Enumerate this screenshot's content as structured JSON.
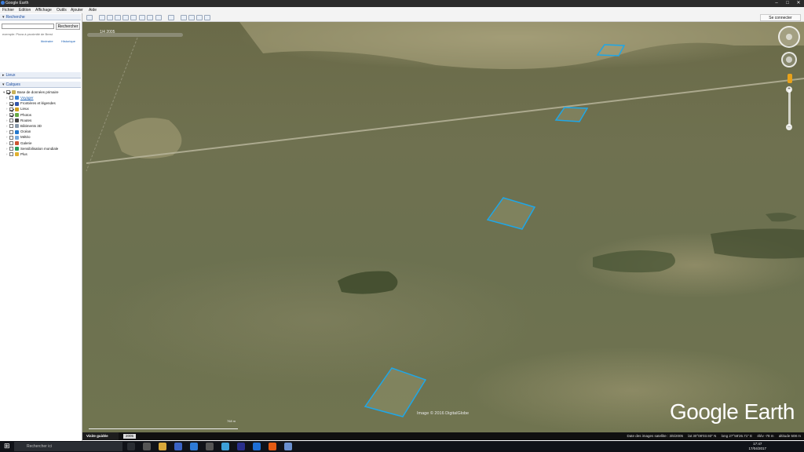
{
  "window": {
    "title": "Google Earth",
    "minimize": "–",
    "maximize": "□",
    "close": "✕"
  },
  "menu": [
    "Fichier",
    "Edition",
    "Affichage",
    "Outils",
    "Ajouter",
    "Aide"
  ],
  "search_panel": {
    "title": "Recherche",
    "input_value": "",
    "button_label": "Rechercher",
    "example": "exemple: Pizza à proximité de Brest",
    "links": [
      "Itinéraire",
      "Historique"
    ]
  },
  "places_panel": {
    "title": "Lieux"
  },
  "layers_panel": {
    "title": "Calques",
    "root": "Base de données primaire",
    "items": [
      {
        "label": "Voyager",
        "checked": false,
        "link": true,
        "icon_color": "#3c86d8"
      },
      {
        "label": "Frontières et légendes",
        "checked": true,
        "link": false,
        "icon_color": "#3355aa"
      },
      {
        "label": "Lieux",
        "checked": true,
        "link": false,
        "icon_color": "#d0a020"
      },
      {
        "label": "Photos",
        "checked": true,
        "link": false,
        "icon_color": "#66aa44"
      },
      {
        "label": "Routes",
        "checked": false,
        "link": false,
        "icon_color": "#444444"
      },
      {
        "label": "Bâtiments 3D",
        "checked": false,
        "link": false,
        "icon_color": "#8899aa"
      },
      {
        "label": "Océan",
        "checked": false,
        "link": false,
        "icon_color": "#2277cc"
      },
      {
        "label": "Météo",
        "checked": false,
        "link": false,
        "icon_color": "#77aadd"
      },
      {
        "label": "Galerie",
        "checked": false,
        "link": false,
        "icon_color": "#cc5533"
      },
      {
        "label": "Sensibilisation mondiale",
        "checked": false,
        "link": false,
        "icon_color": "#2a9d5a"
      },
      {
        "label": "Plus",
        "checked": false,
        "link": false,
        "icon_color": "#e0b030"
      }
    ]
  },
  "toolbar": {
    "signin_label": "Se connecter"
  },
  "view": {
    "scale_label": "1/4 2005",
    "imagery_credit": "Image © 2016 DigitalGlobe",
    "logo": "Google Earth",
    "scalebar_label": "768 m"
  },
  "status": {
    "tour_label": "Visite guidée",
    "history_label": "2005",
    "imagery_date": "Date des images satellite : 3/6/2005",
    "lat": "lat  30°08'03.93\" N",
    "lng": "long  27°58'26.71\" E",
    "elev": "élév  -78 m",
    "altitude": "altitude  508 m"
  },
  "taskbar": {
    "search_placeholder": "Rechercher ici",
    "time": "17:47",
    "date": "17/04/2017"
  },
  "accent": {
    "polygon": "#1ea7e8",
    "header": "#1c4da0"
  }
}
